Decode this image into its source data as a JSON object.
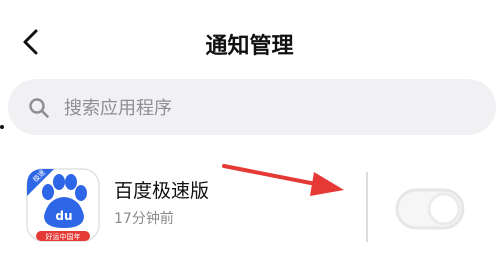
{
  "header": {
    "title": "通知管理",
    "back_icon": "chevron-left-icon"
  },
  "search": {
    "placeholder": "搜索应用程序",
    "icon": "search-icon"
  },
  "app_list": [
    {
      "name": "百度极速版",
      "time": "17分钟前",
      "icon": "baidu-paw-icon",
      "icon_badge_text": "极速",
      "icon_logo_text": "du",
      "icon_banner_text": "好运中国年"
    }
  ],
  "colors": {
    "accent_blue": "#2d66e6",
    "annotation_red": "#e53935",
    "search_bg": "#f1f1f3"
  }
}
